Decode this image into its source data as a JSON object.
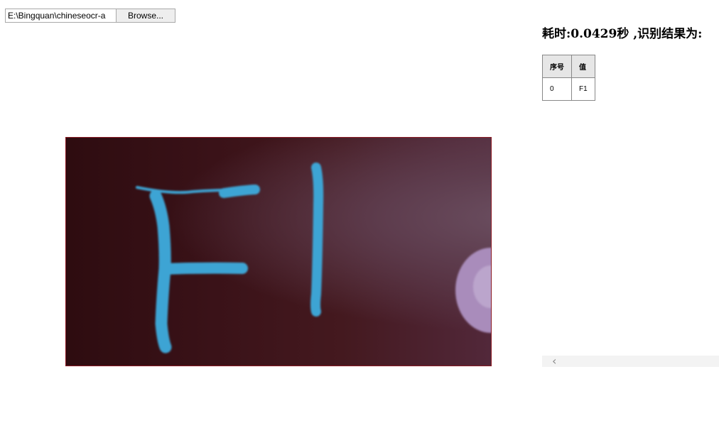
{
  "file_input": {
    "path_value": "E:\\Bingquan\\chineseocr-a",
    "browse_label": "Browse..."
  },
  "result": {
    "title": "耗时:0.0429秒 ,识别结果为:",
    "columns": [
      "序号",
      "值"
    ],
    "rows": [
      [
        "0",
        "F1"
      ]
    ]
  },
  "scrollbar": {
    "left_arrow": "‹"
  },
  "colors": {
    "image_border": "#8b1a24",
    "handwriting": "#3ea4d4"
  },
  "icons": {
    "scroll_left": "chevron-left-icon"
  }
}
